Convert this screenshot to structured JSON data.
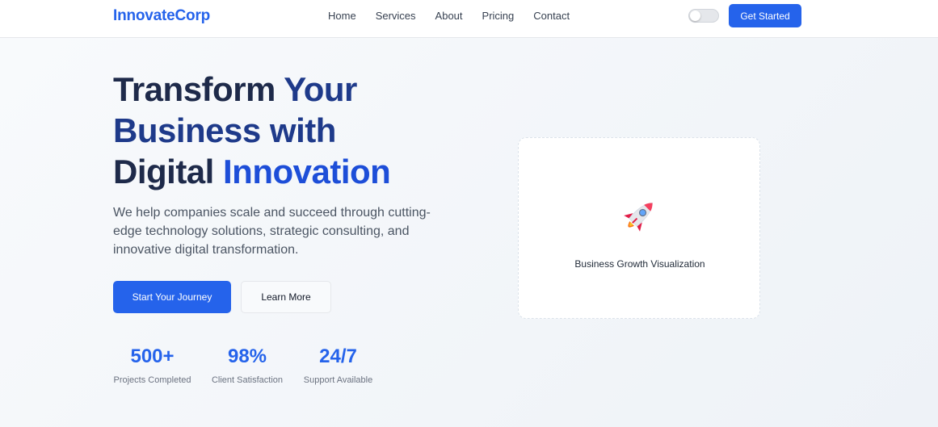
{
  "header": {
    "logo": "InnovateCorp",
    "nav": [
      "Home",
      "Services",
      "About",
      "Pricing",
      "Contact"
    ],
    "theme_toggle": {
      "state": "off"
    },
    "cta": "Get Started"
  },
  "hero": {
    "title_lines": [
      {
        "dark": "Transform ",
        "accent": "Your"
      },
      {
        "dark": "",
        "accent": "Business with"
      },
      {
        "dark": "Digital ",
        "accent": "Innovation"
      }
    ],
    "subtitle": "We help companies scale and succeed through cutting-edge technology solutions, strategic consulting, and innovative digital transformation.",
    "primary_button": "Start Your Journey",
    "secondary_button": "Learn More",
    "stats": [
      {
        "value": "500+",
        "label": "Projects Completed"
      },
      {
        "value": "98%",
        "label": "Client Satisfaction"
      },
      {
        "value": "24/7",
        "label": "Support Available"
      }
    ],
    "visual": {
      "icon": "rocket-icon",
      "caption": "Business Growth Visualization"
    }
  },
  "colors": {
    "brand": "#2563eb",
    "heading_dark": "#1e2a4a",
    "heading_accent": "#1e3a8a",
    "text_muted": "#4b5563"
  }
}
